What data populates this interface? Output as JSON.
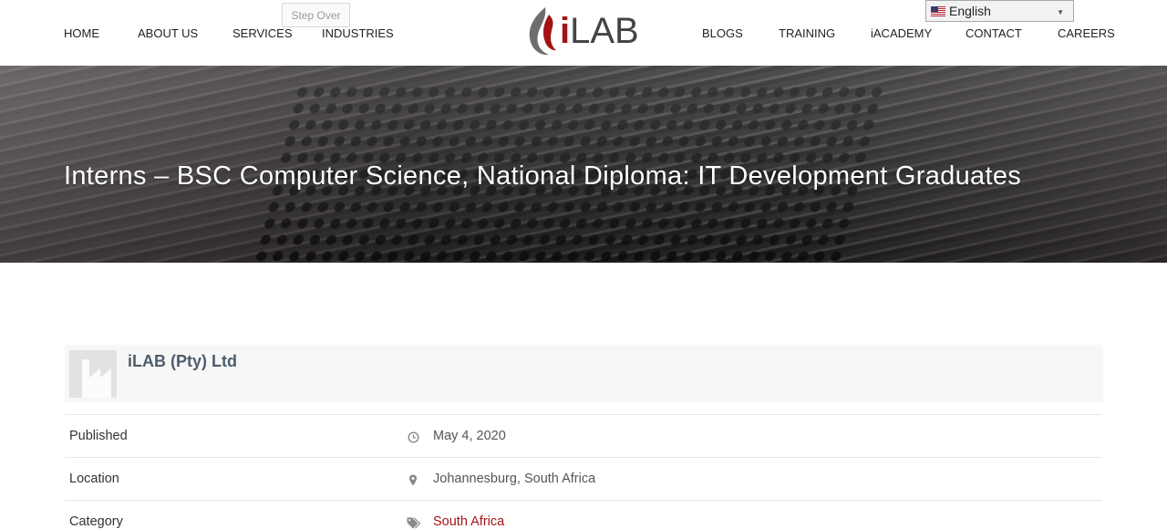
{
  "nav": {
    "left": [
      "HOME",
      "ABOUT US",
      "SERVICES",
      "INDUSTRIES"
    ],
    "right": [
      "BLOGS",
      "TRAINING",
      "iACADEMY",
      "CONTACT",
      "CAREERS"
    ]
  },
  "tooltip": "Step Over",
  "logo": {
    "i": "i",
    "rest": "LAB"
  },
  "language": {
    "selected": "English"
  },
  "hero": {
    "title": "Interns – BSC Computer Science, National Diploma: IT Development Graduates"
  },
  "company": {
    "name": "iLAB (Pty) Ltd"
  },
  "details": [
    {
      "label": "Published",
      "icon": "clock-icon",
      "value": "May 4, 2020"
    },
    {
      "label": "Location",
      "icon": "map-pin-icon",
      "value": "Johannesburg, South Africa"
    },
    {
      "label": "Category",
      "icon": "tags-icon",
      "value": "South Africa"
    }
  ],
  "colors": {
    "accent": "#a31417",
    "company_name": "#4e5d6c"
  }
}
